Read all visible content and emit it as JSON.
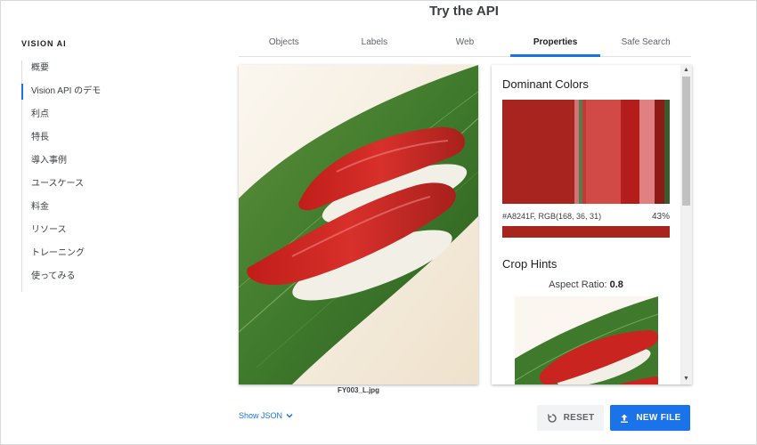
{
  "page": {
    "title": "Try the API"
  },
  "sidebar": {
    "heading": "VISION AI",
    "items": [
      {
        "label": "概要"
      },
      {
        "label": "Vision API のデモ",
        "active": true
      },
      {
        "label": "利点"
      },
      {
        "label": "特長"
      },
      {
        "label": "導入事例"
      },
      {
        "label": "ユースケース"
      },
      {
        "label": "料金"
      },
      {
        "label": "リソース"
      },
      {
        "label": "トレーニング"
      },
      {
        "label": "使ってみる"
      }
    ]
  },
  "tabs": [
    {
      "label": "Objects"
    },
    {
      "label": "Labels"
    },
    {
      "label": "Web"
    },
    {
      "label": "Properties",
      "active": true
    },
    {
      "label": "Safe Search"
    }
  ],
  "image": {
    "filename": "FY003_L.jpg"
  },
  "results": {
    "dominant_colors_title": "Dominant Colors",
    "colors": [
      "#A8241F",
      "#D27373",
      "#5A7A4A",
      "#C23A36",
      "#D24A46",
      "#B41E1A",
      "#E08080",
      "#8E1A16",
      "#3D5A2E"
    ],
    "color_weights": [
      43,
      3,
      2,
      2,
      21,
      11,
      9,
      6,
      3
    ],
    "top_color_text": "#A8241F,  RGB(168, 36, 31)",
    "top_color_percent": "43%",
    "top_color_hex": "#A8241F",
    "crop_hints_title": "Crop Hints",
    "aspect_ratio_label": "Aspect Ratio:",
    "aspect_ratio_value": "0.8"
  },
  "controls": {
    "show_json": "Show JSON",
    "reset": "RESET",
    "new_file": "NEW FILE"
  },
  "colors": {
    "accent": "#1a73e8"
  },
  "icons": {
    "show_json": "chevron-down-icon",
    "reset": "refresh-icon",
    "new_file": "upload-icon"
  }
}
